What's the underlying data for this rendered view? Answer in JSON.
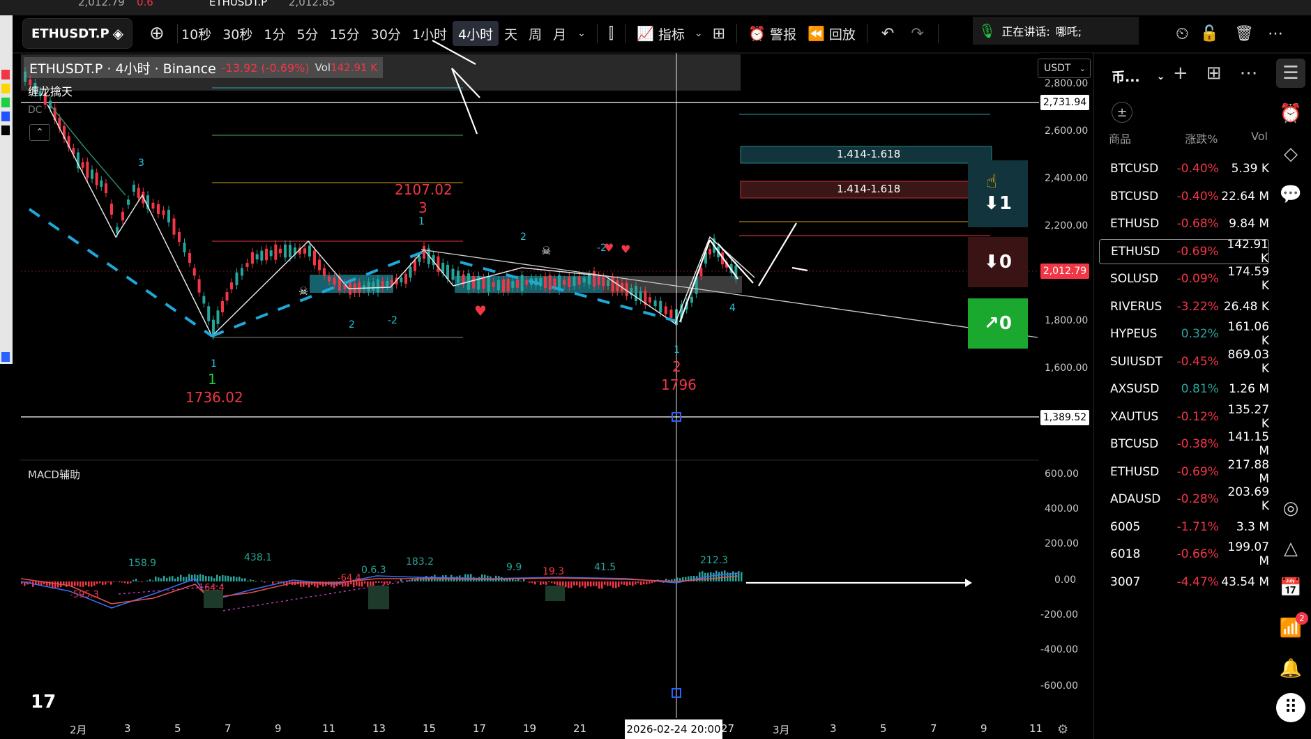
{
  "topbar": {
    "tab1_price": "2,012.79",
    "tab1_chg": "0.6",
    "tab2_name": "ETHUSDT.P",
    "tab2_price": "2,012.85"
  },
  "toolbar": {
    "symbol": "ETHUSDT.P",
    "timeframes": [
      "10秒",
      "30秒",
      "1分",
      "5分",
      "15分",
      "30分",
      "1小时",
      "4小时",
      "天",
      "周",
      "月"
    ],
    "active_timeframe_index": 7,
    "indicators_label": "指标",
    "alert_label": "警报",
    "replay_label": "回放",
    "speaking_label": "正在讲话:",
    "speaking_user": "哪吒;"
  },
  "legend": {
    "title": "ETHUSDT.P · 4小时 · Binance",
    "change": "-13.92 (-0.69%)",
    "vol_label": "Vol",
    "vol_value": "142.91 K",
    "indicator_name": "缠龙擒天",
    "dc_label": "DC"
  },
  "price_axis": {
    "currency": "USDT",
    "ticks": [
      "2,800.00",
      "2,600.00",
      "2,400.00",
      "2,200.00",
      "1,800.00",
      "1,600.00"
    ],
    "tag_high": "2,731.94",
    "tag_current": "2,012.79",
    "tag_low": "1,389.52"
  },
  "macd": {
    "name": "MACD辅助",
    "ticks": [
      "600.00",
      "400.00",
      "200.00",
      "0.00",
      "-200.00",
      "-400.00",
      "-600.00"
    ],
    "labels": [
      "158.9",
      "438.1",
      "0.6.3",
      "183.2",
      "9.9",
      "19.3",
      "41.5",
      "212.3",
      "-64.4",
      "-595.3",
      "-164.4"
    ]
  },
  "chart_annotations": {
    "fib_box_label_1": "1.414-1.618",
    "fib_box_label_2": "1.414-1.618",
    "high_price": "2107.02",
    "high_wave": "3",
    "low1_price": "1736.02",
    "low1_wave": "1",
    "low2_price": "1796",
    "low2_wave": "2",
    "wave_small": [
      "3",
      "2",
      "1",
      "2",
      "-2",
      "1",
      "-2",
      "4",
      "1"
    ],
    "signal_down_1": "⬇1",
    "signal_down_0": "⬇0",
    "signal_up_0": "↗0"
  },
  "time_axis": {
    "labels": [
      "2月",
      "3",
      "5",
      "7",
      "9",
      "11",
      "13",
      "15",
      "17",
      "19",
      "21",
      "27",
      "3月",
      "3",
      "5",
      "7",
      "9",
      "11"
    ],
    "crosshair_date": "2026-02-24  20:00"
  },
  "watchlist": {
    "header": "币...",
    "col_symbol": "商品",
    "col_change": "涨跌%",
    "col_vol": "Vol",
    "rows": [
      {
        "sym": "BTCUSD",
        "chg": "-0.40%",
        "vol": "5.39 K",
        "dir": "neg"
      },
      {
        "sym": "BTCUSD",
        "chg": "-0.40%",
        "vol": "22.64 M",
        "dir": "neg"
      },
      {
        "sym": "ETHUSD",
        "chg": "-0.68%",
        "vol": "9.84 M",
        "dir": "neg"
      },
      {
        "sym": "ETHUSD",
        "chg": "-0.69%",
        "vol": "142.91 K",
        "dir": "neg"
      },
      {
        "sym": "SOLUSD",
        "chg": "-0.09%",
        "vol": "174.59 K",
        "dir": "neg"
      },
      {
        "sym": "RIVERUS",
        "chg": "-3.22%",
        "vol": "26.48 K",
        "dir": "neg"
      },
      {
        "sym": "HYPEUS",
        "chg": "0.32%",
        "vol": "161.06 K",
        "dir": "pos"
      },
      {
        "sym": "SUIUSDT",
        "chg": "-0.45%",
        "vol": "869.03 K",
        "dir": "neg"
      },
      {
        "sym": "AXSUSD",
        "chg": "0.81%",
        "vol": "1.26 M",
        "dir": "pos"
      },
      {
        "sym": "XAUTUS",
        "chg": "-0.12%",
        "vol": "135.27 K",
        "dir": "neg"
      },
      {
        "sym": "BTCUSD",
        "chg": "-0.38%",
        "vol": "141.15 M",
        "dir": "neg"
      },
      {
        "sym": "ETHUSD",
        "chg": "-0.69%",
        "vol": "217.88 M",
        "dir": "neg"
      },
      {
        "sym": "ADAUSD",
        "chg": "-0.28%",
        "vol": "203.69 K",
        "dir": "neg"
      },
      {
        "sym": "6005",
        "chg": "-1.71%",
        "vol": "3.3 M",
        "dir": "neg"
      },
      {
        "sym": "6018",
        "chg": "-0.66%",
        "vol": "199.07 M",
        "dir": "neg"
      },
      {
        "sym": "3007",
        "chg": "-4.47%",
        "vol": "43.54 M",
        "dir": "neg"
      }
    ],
    "selected_index": 3
  },
  "notification_count": "2",
  "colors": {
    "up": "#26a69a",
    "down": "#f23645",
    "accent": "#2962ff"
  }
}
